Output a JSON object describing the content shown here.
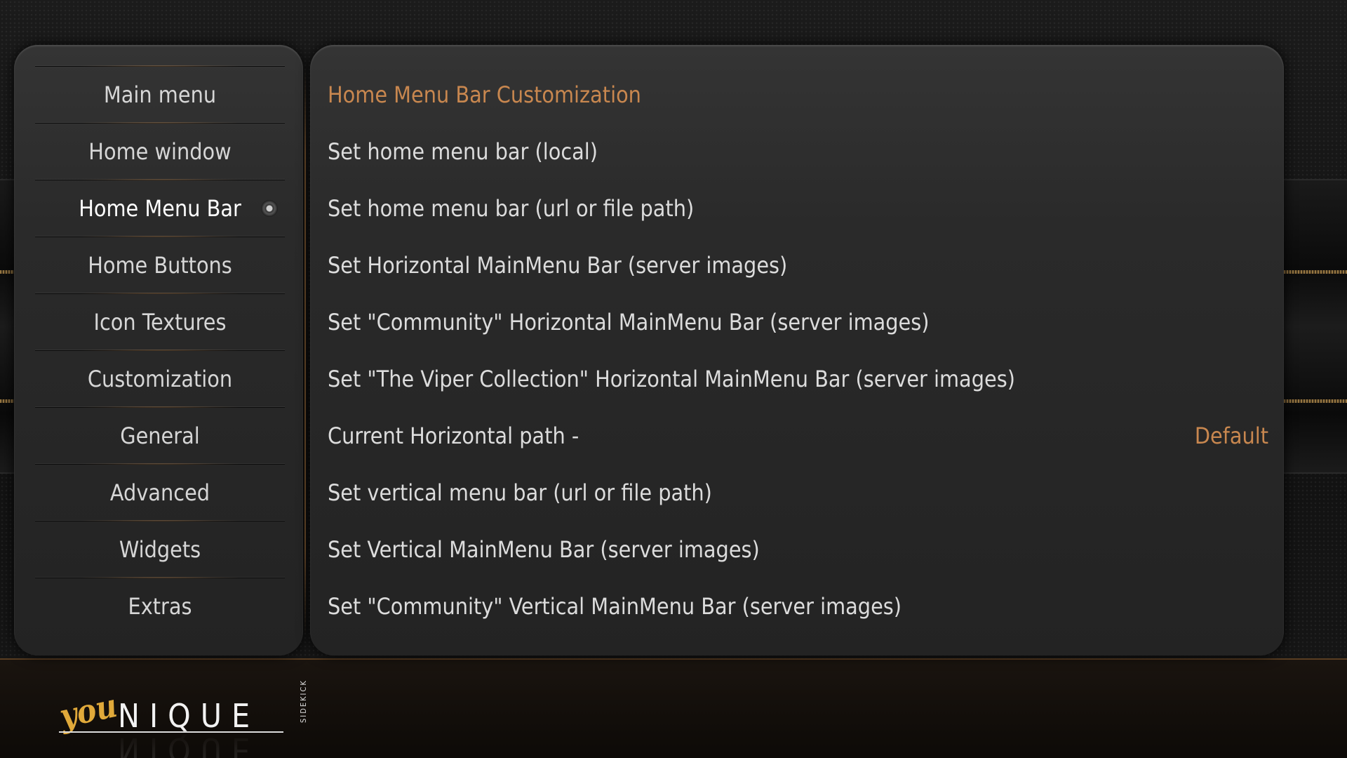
{
  "sidebar": {
    "items": [
      {
        "label": "Main menu"
      },
      {
        "label": "Home window"
      },
      {
        "label": "Home Menu Bar"
      },
      {
        "label": "Home Buttons"
      },
      {
        "label": "Icon Textures"
      },
      {
        "label": "Customization"
      },
      {
        "label": "General"
      },
      {
        "label": "Advanced"
      },
      {
        "label": "Widgets"
      },
      {
        "label": "Extras"
      }
    ],
    "selected_index": 2
  },
  "main": {
    "header": "Home Menu Bar Customization",
    "rows": [
      {
        "label": "Set home menu bar (local)"
      },
      {
        "label": "Set home menu bar (url or file path)"
      },
      {
        "label": "Set Horizontal MainMenu Bar (server images)"
      },
      {
        "label": "Set \"Community\" Horizontal MainMenu Bar (server images)"
      },
      {
        "label": "Set \"The Viper Collection\" Horizontal MainMenu Bar (server images)"
      },
      {
        "label": "Current Horizontal path -",
        "value": "Default"
      },
      {
        "label": "Set vertical menu bar (url or file path)"
      },
      {
        "label": "Set Vertical MainMenu Bar (server images)"
      },
      {
        "label": "Set \"Community\" Vertical MainMenu Bar (server images)"
      }
    ]
  },
  "logo": {
    "prefix": "you",
    "name": "NIQUE",
    "tag": "SIDEKICK"
  },
  "colors": {
    "accent": "#c8874f",
    "text": "#dcdcdc",
    "panel": "#2a2a2a",
    "background": "#121212"
  }
}
